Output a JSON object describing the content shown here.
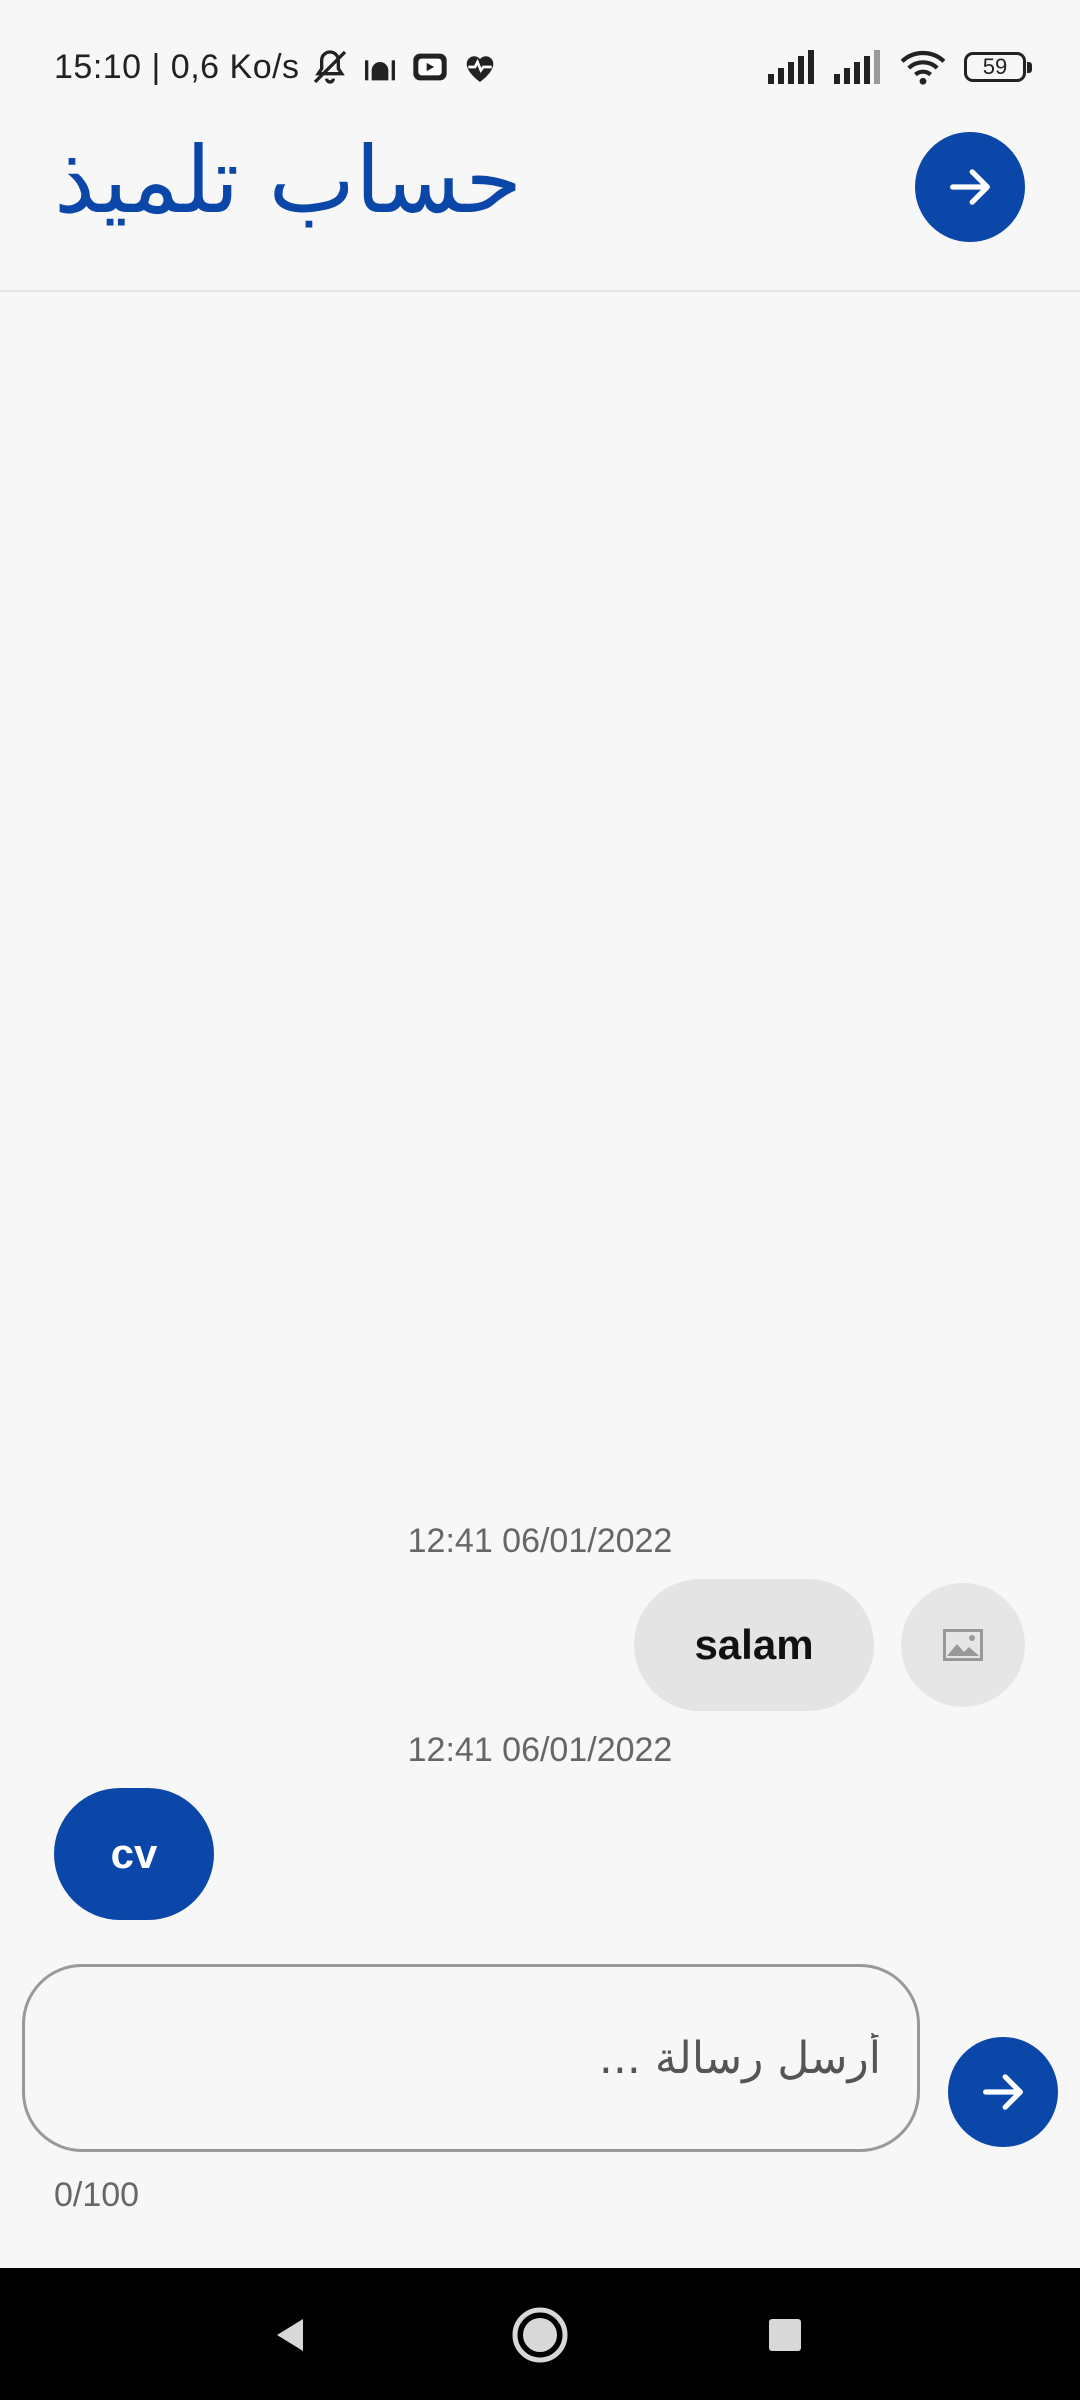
{
  "status_bar": {
    "time_speed": "15:10 | 0,6 Ko/s",
    "battery": "59",
    "icons": [
      "bell-off-icon",
      "mosque-icon",
      "youtube-icon",
      "heart-icon",
      "signal-icon",
      "signal-icon",
      "wifi-icon",
      "battery-icon"
    ]
  },
  "header": {
    "title": "حساب تلميذ",
    "back_icon": "arrow-right-icon"
  },
  "messages": [
    {
      "timestamp": "12:41 06/01/2022",
      "text": "salam",
      "side": "right",
      "avatar_icon": "image-placeholder-icon"
    },
    {
      "timestamp": "12:41 06/01/2022",
      "text": "cv",
      "side": "left"
    }
  ],
  "composer": {
    "placeholder": "أرسل رسالة ...",
    "value": "",
    "counter": "0/100",
    "send_icon": "arrow-right-icon"
  },
  "navbar": {
    "icons": [
      "back-triangle-icon",
      "home-circle-icon",
      "recents-square-icon"
    ]
  },
  "colors": {
    "accent": "#0a47a9",
    "background": "#f7f7f7",
    "bubble_me": "#e4e4e4"
  }
}
